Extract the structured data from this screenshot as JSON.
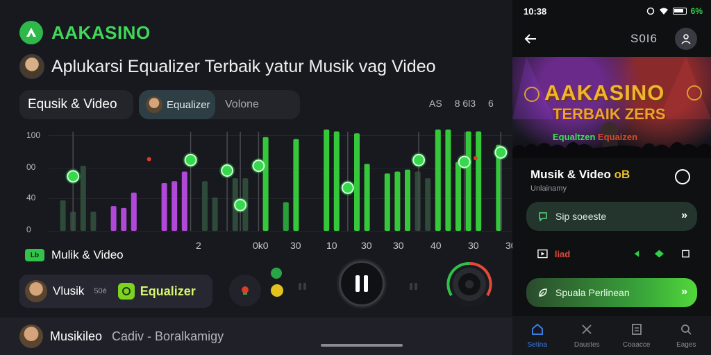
{
  "app": {
    "brand": "AAKASINO"
  },
  "headline": "Aplukarsi Equalizer Terbaik yatur Musik vag Video",
  "tabs": {
    "musik": "Equsik & Video",
    "equalizer": "Equalizer",
    "volume": "Volone"
  },
  "top_labels": [
    "AS",
    "8 6l3",
    "6"
  ],
  "chart_data": {
    "type": "bar",
    "y_ticks": [
      "100",
      "00",
      "40",
      "0"
    ],
    "x_ticks": [
      "2",
      "0k0",
      "30",
      "10",
      "30",
      "30",
      "40",
      "30",
      "30"
    ],
    "bars": [
      {
        "x": 1,
        "h": 0.32,
        "color": "#2e4a38"
      },
      {
        "x": 2,
        "h": 0.2,
        "color": "#2e4a38"
      },
      {
        "x": 3,
        "h": 0.68,
        "color": "#2e4a38"
      },
      {
        "x": 4,
        "h": 0.2,
        "color": "#2e4a38"
      },
      {
        "x": 6,
        "h": 0.26,
        "color": "#b048d8"
      },
      {
        "x": 7,
        "h": 0.24,
        "color": "#b048d8"
      },
      {
        "x": 8,
        "h": 0.4,
        "color": "#b048d8"
      },
      {
        "x": 11,
        "h": 0.5,
        "color": "#b048d8"
      },
      {
        "x": 12,
        "h": 0.52,
        "color": "#b048d8"
      },
      {
        "x": 13,
        "h": 0.62,
        "color": "#b048d8"
      },
      {
        "x": 15,
        "h": 0.52,
        "color": "#2e4a38"
      },
      {
        "x": 16,
        "h": 0.35,
        "color": "#2e4a38"
      },
      {
        "x": 18,
        "h": 0.55,
        "color": "#2e4a38"
      },
      {
        "x": 19,
        "h": 0.55,
        "color": "#2e4a38"
      },
      {
        "x": 21,
        "h": 0.98,
        "color": "#35c83a"
      },
      {
        "x": 23,
        "h": 0.3,
        "color": "#2aa03a"
      },
      {
        "x": 24,
        "h": 0.96,
        "color": "#35c83a"
      },
      {
        "x": 27,
        "h": 1.06,
        "color": "#35c83a"
      },
      {
        "x": 28,
        "h": 1.04,
        "color": "#35c83a"
      },
      {
        "x": 30,
        "h": 1.02,
        "color": "#35c83a"
      },
      {
        "x": 31,
        "h": 0.7,
        "color": "#35c83a"
      },
      {
        "x": 33,
        "h": 0.6,
        "color": "#35c83a"
      },
      {
        "x": 34,
        "h": 0.62,
        "color": "#35c83a"
      },
      {
        "x": 35,
        "h": 0.64,
        "color": "#35c83a"
      },
      {
        "x": 36,
        "h": 0.62,
        "color": "#2e4a38"
      },
      {
        "x": 37,
        "h": 0.55,
        "color": "#2e4a38"
      },
      {
        "x": 38,
        "h": 1.06,
        "color": "#35c83a"
      },
      {
        "x": 39,
        "h": 1.06,
        "color": "#35c83a"
      },
      {
        "x": 40,
        "h": 0.72,
        "color": "#35c83a"
      },
      {
        "x": 41,
        "h": 1.04,
        "color": "#35c83a"
      },
      {
        "x": 42,
        "h": 1.04,
        "color": "#35c83a"
      },
      {
        "x": 44,
        "h": 0.9,
        "color": "#35c83a"
      }
    ],
    "knobs": [
      {
        "x": 2,
        "level": 0.57
      },
      {
        "x": 13.6,
        "level": 0.74
      },
      {
        "x": 17.2,
        "level": 0.63
      },
      {
        "x": 18.5,
        "level": 0.27
      },
      {
        "x": 20.3,
        "level": 0.68
      },
      {
        "x": 29.1,
        "level": 0.45
      },
      {
        "x": 36.1,
        "level": 0.74
      },
      {
        "x": 40.6,
        "level": 0.72
      },
      {
        "x": 44.2,
        "level": 0.82
      }
    ],
    "red_markers": [
      {
        "x": 9.5,
        "level": 0.75
      },
      {
        "x": 41.7,
        "level": 0.76
      }
    ]
  },
  "legend": {
    "chip": "Lb",
    "label": "Mulik & Video"
  },
  "track": {
    "title": "Vlusik",
    "sub": "50é",
    "eq_label": "Equalizer"
  },
  "bottom": {
    "title": "Musikileo",
    "sub": "Cadiv - Boralkamigy"
  },
  "status": {
    "time": "10:38",
    "battery": "6%"
  },
  "phone": {
    "appbar_title": "S0I6",
    "banner": {
      "title": "AAKASINO",
      "sub": "TERBAIK ZERS",
      "cap_a": "Equaltzen ",
      "cap_b": "Equaizen"
    },
    "heading": "Musik & Video ",
    "heading_badge": "oB",
    "subheading": "Unlainamy",
    "btn1": "Sip soeeste",
    "row_label": "liad",
    "btn2": "Spuala Perlinean",
    "tabbar": [
      "Setina",
      "Daustes",
      "Coaacce",
      "Eages"
    ]
  }
}
